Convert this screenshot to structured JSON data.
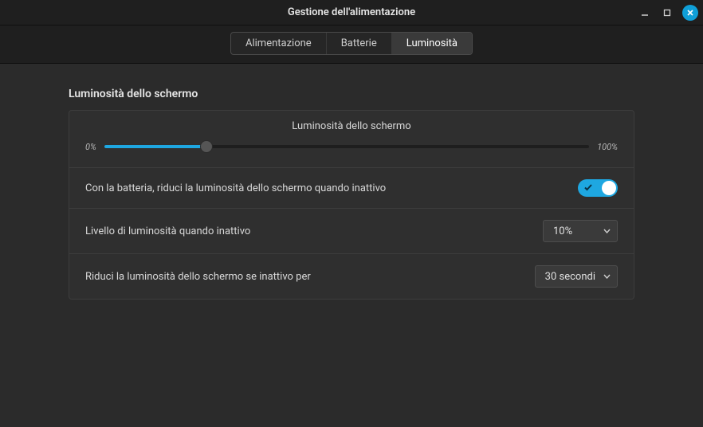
{
  "window": {
    "title": "Gestione dell'alimentazione"
  },
  "tabs": {
    "t0": "Alimentazione",
    "t1": "Batterie",
    "t2": "Luminosità"
  },
  "section": {
    "title": "Luminosità dello schermo"
  },
  "brightness": {
    "panel_title": "Luminosità dello schermo",
    "min_label": "0%",
    "max_label": "100%",
    "value_percent": 21
  },
  "rows": {
    "reduce_on_battery_label": "Con la batteria, riduci la luminosità dello schermo quando inattivo",
    "reduce_on_battery_on": true,
    "idle_level_label": "Livello di luminosità quando inattivo",
    "idle_level_value": "10%",
    "idle_after_label": "Riduci la luminosità dello schermo se inattivo per",
    "idle_after_value": "30 secondi"
  }
}
